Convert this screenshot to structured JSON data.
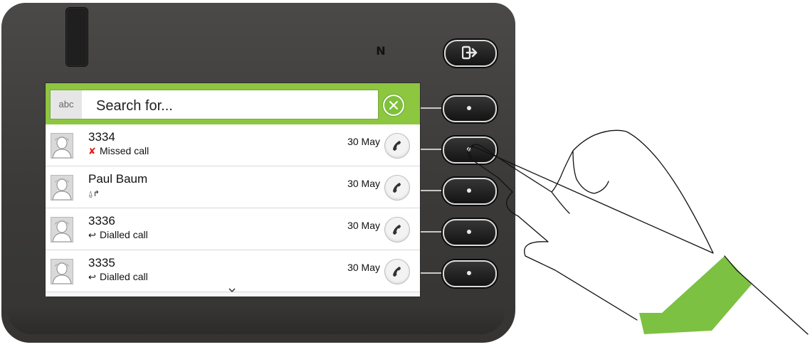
{
  "phone": {
    "icons": [
      "nfc-icon",
      "exit-icon"
    ],
    "nfc_glyph": "N"
  },
  "search": {
    "mode_label": "abc",
    "placeholder": "Search for..."
  },
  "calls": [
    {
      "name": "3334",
      "type_label": "Missed call",
      "type_icon": "missed-call-icon",
      "date": "30 May"
    },
    {
      "name": "Paul Baum",
      "type_label": "",
      "type_icon": "forwarded-call-icon",
      "date": "30 May"
    },
    {
      "name": "3336",
      "type_label": "Dialled call",
      "type_icon": "dialled-call-icon",
      "date": "30 May"
    },
    {
      "name": "3335",
      "type_label": "Dialled call",
      "type_icon": "dialled-call-icon",
      "date": "30 May"
    }
  ],
  "colors": {
    "accent_green": "#8dc63f",
    "missed_red": "#e0201b",
    "phone_body": "#3b3a39"
  }
}
